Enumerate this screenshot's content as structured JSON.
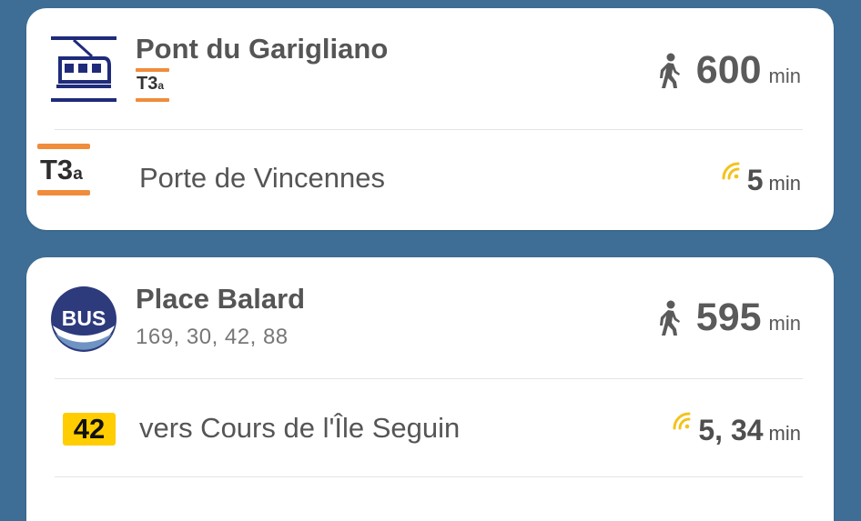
{
  "stops": [
    {
      "name": "Pont du Garigliano",
      "line_badge": {
        "main": "T3",
        "sup": "a"
      },
      "walk_time": "600",
      "walk_unit": "min",
      "departure": {
        "line_badge": {
          "main": "T3",
          "sup": "a"
        },
        "destination": "Porte de Vincennes",
        "times": "5",
        "unit": "min"
      }
    },
    {
      "name": "Place Balard",
      "bus_logo": "BUS",
      "lines": "169, 30, 42, 88",
      "walk_time": "595",
      "walk_unit": "min",
      "departure": {
        "line_badge": "42",
        "destination": "vers Cours de l'Île Seguin",
        "times": "5, 34",
        "unit": "min"
      }
    }
  ],
  "icons": {
    "tram": "tram-icon",
    "walk": "walking-person-icon",
    "realtime": "realtime-signal-icon",
    "bus": "bus-logo-icon"
  },
  "colors": {
    "background": "#3e6e95",
    "tram_line_orange": "#f08c3b",
    "tram_icon_navy": "#1f2b7a",
    "bus_line_yellow": "#ffcd00",
    "realtime_yellow": "#f3c21b"
  }
}
